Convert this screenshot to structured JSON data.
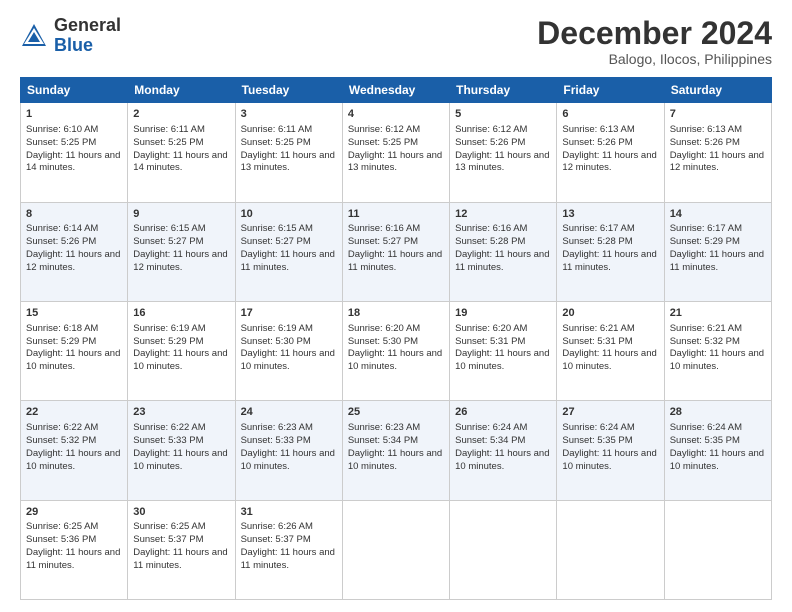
{
  "logo": {
    "general": "General",
    "blue": "Blue"
  },
  "title": {
    "month": "December 2024",
    "location": "Balogo, Ilocos, Philippines"
  },
  "headers": [
    "Sunday",
    "Monday",
    "Tuesday",
    "Wednesday",
    "Thursday",
    "Friday",
    "Saturday"
  ],
  "weeks": [
    [
      {
        "day": "1",
        "sunrise": "Sunrise: 6:10 AM",
        "sunset": "Sunset: 5:25 PM",
        "daylight": "Daylight: 11 hours and 14 minutes."
      },
      {
        "day": "2",
        "sunrise": "Sunrise: 6:11 AM",
        "sunset": "Sunset: 5:25 PM",
        "daylight": "Daylight: 11 hours and 14 minutes."
      },
      {
        "day": "3",
        "sunrise": "Sunrise: 6:11 AM",
        "sunset": "Sunset: 5:25 PM",
        "daylight": "Daylight: 11 hours and 13 minutes."
      },
      {
        "day": "4",
        "sunrise": "Sunrise: 6:12 AM",
        "sunset": "Sunset: 5:25 PM",
        "daylight": "Daylight: 11 hours and 13 minutes."
      },
      {
        "day": "5",
        "sunrise": "Sunrise: 6:12 AM",
        "sunset": "Sunset: 5:26 PM",
        "daylight": "Daylight: 11 hours and 13 minutes."
      },
      {
        "day": "6",
        "sunrise": "Sunrise: 6:13 AM",
        "sunset": "Sunset: 5:26 PM",
        "daylight": "Daylight: 11 hours and 12 minutes."
      },
      {
        "day": "7",
        "sunrise": "Sunrise: 6:13 AM",
        "sunset": "Sunset: 5:26 PM",
        "daylight": "Daylight: 11 hours and 12 minutes."
      }
    ],
    [
      {
        "day": "8",
        "sunrise": "Sunrise: 6:14 AM",
        "sunset": "Sunset: 5:26 PM",
        "daylight": "Daylight: 11 hours and 12 minutes."
      },
      {
        "day": "9",
        "sunrise": "Sunrise: 6:15 AM",
        "sunset": "Sunset: 5:27 PM",
        "daylight": "Daylight: 11 hours and 12 minutes."
      },
      {
        "day": "10",
        "sunrise": "Sunrise: 6:15 AM",
        "sunset": "Sunset: 5:27 PM",
        "daylight": "Daylight: 11 hours and 11 minutes."
      },
      {
        "day": "11",
        "sunrise": "Sunrise: 6:16 AM",
        "sunset": "Sunset: 5:27 PM",
        "daylight": "Daylight: 11 hours and 11 minutes."
      },
      {
        "day": "12",
        "sunrise": "Sunrise: 6:16 AM",
        "sunset": "Sunset: 5:28 PM",
        "daylight": "Daylight: 11 hours and 11 minutes."
      },
      {
        "day": "13",
        "sunrise": "Sunrise: 6:17 AM",
        "sunset": "Sunset: 5:28 PM",
        "daylight": "Daylight: 11 hours and 11 minutes."
      },
      {
        "day": "14",
        "sunrise": "Sunrise: 6:17 AM",
        "sunset": "Sunset: 5:29 PM",
        "daylight": "Daylight: 11 hours and 11 minutes."
      }
    ],
    [
      {
        "day": "15",
        "sunrise": "Sunrise: 6:18 AM",
        "sunset": "Sunset: 5:29 PM",
        "daylight": "Daylight: 11 hours and 10 minutes."
      },
      {
        "day": "16",
        "sunrise": "Sunrise: 6:19 AM",
        "sunset": "Sunset: 5:29 PM",
        "daylight": "Daylight: 11 hours and 10 minutes."
      },
      {
        "day": "17",
        "sunrise": "Sunrise: 6:19 AM",
        "sunset": "Sunset: 5:30 PM",
        "daylight": "Daylight: 11 hours and 10 minutes."
      },
      {
        "day": "18",
        "sunrise": "Sunrise: 6:20 AM",
        "sunset": "Sunset: 5:30 PM",
        "daylight": "Daylight: 11 hours and 10 minutes."
      },
      {
        "day": "19",
        "sunrise": "Sunrise: 6:20 AM",
        "sunset": "Sunset: 5:31 PM",
        "daylight": "Daylight: 11 hours and 10 minutes."
      },
      {
        "day": "20",
        "sunrise": "Sunrise: 6:21 AM",
        "sunset": "Sunset: 5:31 PM",
        "daylight": "Daylight: 11 hours and 10 minutes."
      },
      {
        "day": "21",
        "sunrise": "Sunrise: 6:21 AM",
        "sunset": "Sunset: 5:32 PM",
        "daylight": "Daylight: 11 hours and 10 minutes."
      }
    ],
    [
      {
        "day": "22",
        "sunrise": "Sunrise: 6:22 AM",
        "sunset": "Sunset: 5:32 PM",
        "daylight": "Daylight: 11 hours and 10 minutes."
      },
      {
        "day": "23",
        "sunrise": "Sunrise: 6:22 AM",
        "sunset": "Sunset: 5:33 PM",
        "daylight": "Daylight: 11 hours and 10 minutes."
      },
      {
        "day": "24",
        "sunrise": "Sunrise: 6:23 AM",
        "sunset": "Sunset: 5:33 PM",
        "daylight": "Daylight: 11 hours and 10 minutes."
      },
      {
        "day": "25",
        "sunrise": "Sunrise: 6:23 AM",
        "sunset": "Sunset: 5:34 PM",
        "daylight": "Daylight: 11 hours and 10 minutes."
      },
      {
        "day": "26",
        "sunrise": "Sunrise: 6:24 AM",
        "sunset": "Sunset: 5:34 PM",
        "daylight": "Daylight: 11 hours and 10 minutes."
      },
      {
        "day": "27",
        "sunrise": "Sunrise: 6:24 AM",
        "sunset": "Sunset: 5:35 PM",
        "daylight": "Daylight: 11 hours and 10 minutes."
      },
      {
        "day": "28",
        "sunrise": "Sunrise: 6:24 AM",
        "sunset": "Sunset: 5:35 PM",
        "daylight": "Daylight: 11 hours and 10 minutes."
      }
    ],
    [
      {
        "day": "29",
        "sunrise": "Sunrise: 6:25 AM",
        "sunset": "Sunset: 5:36 PM",
        "daylight": "Daylight: 11 hours and 11 minutes."
      },
      {
        "day": "30",
        "sunrise": "Sunrise: 6:25 AM",
        "sunset": "Sunset: 5:37 PM",
        "daylight": "Daylight: 11 hours and 11 minutes."
      },
      {
        "day": "31",
        "sunrise": "Sunrise: 6:26 AM",
        "sunset": "Sunset: 5:37 PM",
        "daylight": "Daylight: 11 hours and 11 minutes."
      },
      null,
      null,
      null,
      null
    ]
  ]
}
